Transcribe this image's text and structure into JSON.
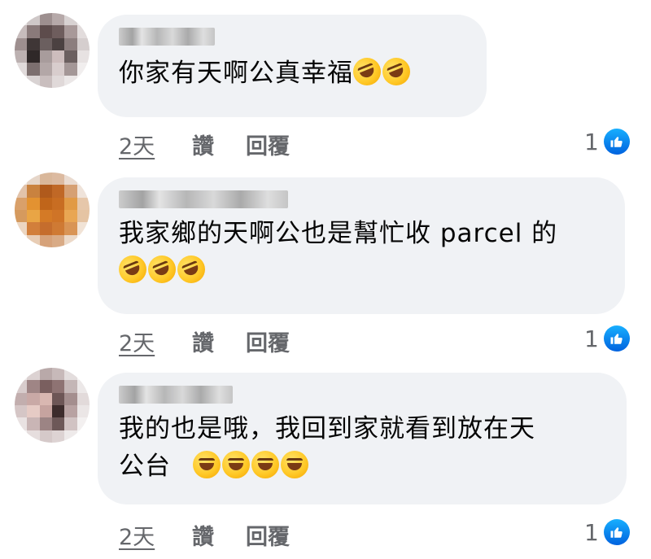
{
  "comments": [
    {
      "text": "你家有天啊公真幸福",
      "emojis": [
        "rolling-on-floor-laughing",
        "rolling-on-floor-laughing"
      ],
      "time": "2天",
      "like_label": "讚",
      "reply_label": "回覆",
      "like_count": "1"
    },
    {
      "text": "我家鄉的天啊公也是幫忙收 parcel 的",
      "emojis": [
        "rolling-on-floor-laughing",
        "rolling-on-floor-laughing",
        "rolling-on-floor-laughing"
      ],
      "time": "2天",
      "like_label": "讚",
      "reply_label": "回覆",
      "like_count": "1"
    },
    {
      "text_line1": "我的也是哦，我回到家就看到放在天",
      "text_line2": "公台",
      "emojis": [
        "face-with-tears-of-joy",
        "face-with-tears-of-joy",
        "face-with-tears-of-joy",
        "face-with-tears-of-joy"
      ],
      "time": "2天",
      "like_label": "讚",
      "reply_label": "回覆",
      "like_count": "1"
    }
  ],
  "colors": {
    "bubble": "#f0f2f5",
    "meta_text": "#65676b",
    "like_blue": "#1877f2"
  }
}
